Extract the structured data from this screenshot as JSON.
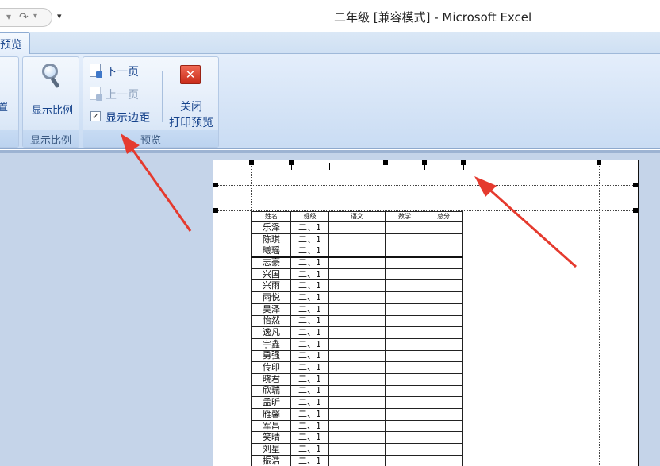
{
  "window": {
    "title": "二年级 [兼容模式] - Microsoft Excel"
  },
  "quick_access": {
    "undo_arrow": "▾",
    "redo": "↷",
    "redo_arrow": "▾",
    "more": "▾"
  },
  "tabs": {
    "active": "预览"
  },
  "ribbon": {
    "groups": [
      {
        "label": "",
        "button": "置"
      },
      {
        "label": "显示比例",
        "button": "显示比例"
      },
      {
        "label": "预览",
        "next_page": "下一页",
        "prev_page": "上一页",
        "show_margins": {
          "label": "显示边距",
          "checked": true,
          "mark": "✓"
        },
        "close": {
          "line1": "关闭",
          "line2": "打印预览",
          "glyph": "✕"
        }
      }
    ]
  },
  "sheet": {
    "headers": [
      "姓名",
      "班级",
      "语文",
      "数学",
      "总分"
    ],
    "rows": [
      [
        "乐泽",
        "二、1"
      ],
      [
        "陈琪",
        "二、1"
      ],
      [
        "曦瑶",
        "二、1"
      ],
      [
        "志豪",
        "二、1"
      ],
      [
        "兴国",
        "二、1"
      ],
      [
        "兴雨",
        "二、1"
      ],
      [
        "雨悦",
        "二、1"
      ],
      [
        "昊泽",
        "二、1"
      ],
      [
        "怡然",
        "二、1"
      ],
      [
        "逸凡",
        "二、1"
      ],
      [
        "宇鑫",
        "二、1"
      ],
      [
        "勇强",
        "二、1"
      ],
      [
        "传印",
        "二、1"
      ],
      [
        "晓君",
        "二、1"
      ],
      [
        "欣瑞",
        "二、1"
      ],
      [
        "孟昕",
        "二、1"
      ],
      [
        "雁馨",
        "二、1"
      ],
      [
        "军昌",
        "二、1"
      ],
      [
        "笑晴",
        "二、1"
      ],
      [
        "刘星",
        "二、1"
      ],
      [
        "振浩",
        "二、1"
      ]
    ]
  },
  "colors": {
    "ribbon_text": "#15428b",
    "annotation_arrow": "#e53a2e",
    "close_button": "#d9402c"
  }
}
